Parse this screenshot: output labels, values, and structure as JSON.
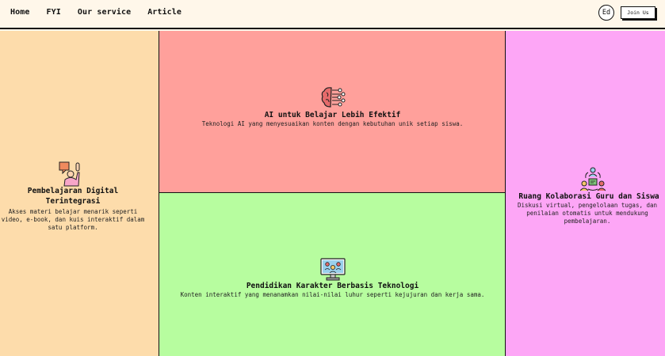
{
  "nav": {
    "links": [
      "Home",
      "FYI",
      "Our service",
      "Article"
    ],
    "avatar": "Ed",
    "join_label": "Join Us"
  },
  "features": {
    "learning": {
      "icon": "raised-hand-icon",
      "title": "Pembelajaran Digital Terintegrasi",
      "desc": "Akses materi belajar menarik seperti video, e-book, dan kuis interaktif dalam satu platform."
    },
    "ai": {
      "icon": "ai-brain-icon",
      "title": "AI untuk Belajar Lebih Efektif",
      "desc": "Teknologi AI yang menyesuaikan konten dengan kebutuhan unik setiap siswa."
    },
    "character": {
      "icon": "monitor-people-icon",
      "title": "Pendidikan Karakter Berbasis Teknologi",
      "desc": "Konten interaktif yang menanamkan nilai-nilai luhur seperti kejujuran dan kerja sama."
    },
    "collab": {
      "icon": "collaboration-icon",
      "title": "Ruang Kolaborasi Guru dan Siswa",
      "desc": "Diskusi virtual, pengelolaan tugas, dan penilaian otomatis untuk mendukung pembelajaran."
    }
  },
  "colors": {
    "learning_bg": "#fddcab",
    "ai_bg": "#ffa09b",
    "character_bg": "#b7fd9f",
    "collab_bg": "#fda6f6"
  }
}
